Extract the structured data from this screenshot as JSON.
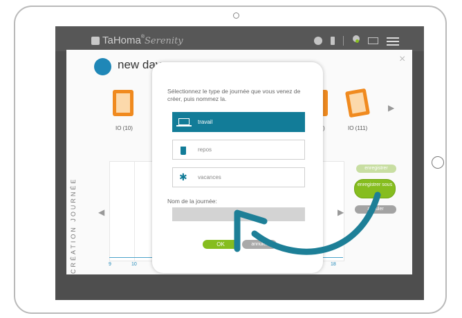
{
  "app": {
    "brand": "TaHoma",
    "brand_suffix": "®",
    "brand_sub": "Serenity"
  },
  "dialog": {
    "title": "new day",
    "close": "×",
    "vertical_label": "CRÉATION JOURNÉE",
    "devices": [
      {
        "label": "IO (10)"
      },
      {
        "label": ")"
      },
      {
        "label": "IO (111)"
      }
    ],
    "chart_ticks": [
      "9",
      "10",
      "18"
    ],
    "buttons": {
      "enregistrer": "enregistrer",
      "enregistrer_sous": "enregistrer sous",
      "annuler": "annuler"
    }
  },
  "overlay": {
    "instruction": "Sélectionnez le type de journée que vous venez de créer, puis nommez la.",
    "options": [
      {
        "label": "travail",
        "icon": "laptop-icon",
        "selected": true
      },
      {
        "label": "repos",
        "icon": "drink-icon",
        "selected": false
      },
      {
        "label": "vacances",
        "icon": "palm-tree-icon",
        "selected": false
      }
    ],
    "name_label": "Nom de la journée:",
    "name_value": "",
    "ok": "OK",
    "cancel": "annuler"
  },
  "colors": {
    "accent_teal": "#127c98",
    "accent_blue": "#1f87b7",
    "ok_green": "#86bd1f",
    "arrow_teal": "#1d7f97",
    "device_orange": "#f08a1f"
  }
}
